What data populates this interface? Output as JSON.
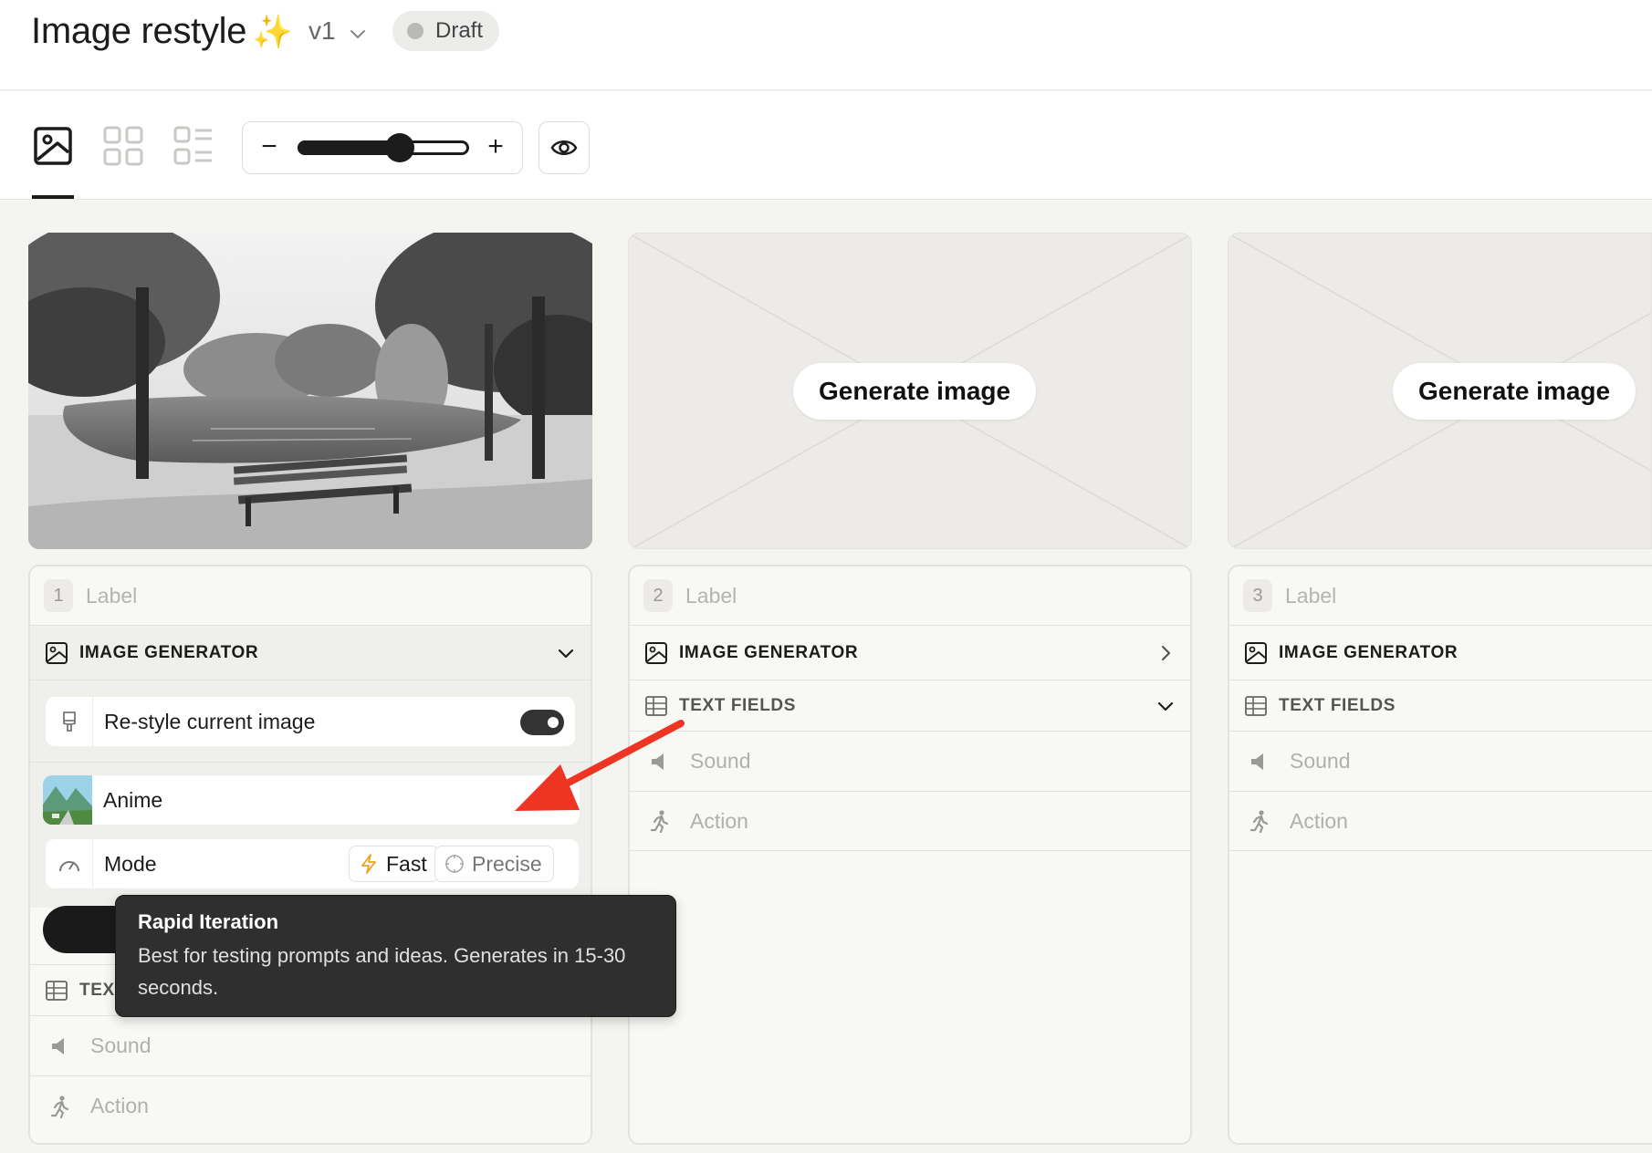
{
  "header": {
    "title": "Image restyle",
    "sparkle": "✨",
    "version": "v1",
    "status": "Draft"
  },
  "toolbar": {
    "view_modes": [
      "single-image-view",
      "grid-view",
      "list-view"
    ],
    "active_view": "single-image-view",
    "zoom_minus": "−",
    "zoom_plus": "+",
    "zoom_level": 0.58
  },
  "columns": [
    {
      "number": "1",
      "label_placeholder": "Label",
      "image_generator_title": "IMAGE GENERATOR",
      "restyle_label": "Re-style current image",
      "restyle_enabled": true,
      "style_name": "Anime",
      "mode_label": "Mode",
      "mode_options": [
        "Fast",
        "Precise"
      ],
      "text_fields_title": "TEXT FIELDS",
      "sound_label": "Sound",
      "action_label": "Action"
    },
    {
      "number": "2",
      "label_placeholder": "Label",
      "generate_label": "Generate image",
      "image_generator_title": "IMAGE GENERATOR",
      "text_fields_title": "TEXT FIELDS",
      "sound_label": "Sound",
      "action_label": "Action"
    },
    {
      "number": "3",
      "label_placeholder": "Label",
      "generate_label": "Generate image",
      "image_generator_title": "IMAGE GENERATOR",
      "text_fields_title": "TEXT FIELDS",
      "sound_label": "Sound",
      "action_label": "Action"
    }
  ],
  "tooltip": {
    "title": "Rapid Iteration",
    "body": "Best for testing prompts and ideas. Generates in 15-30 seconds."
  },
  "colors": {
    "accent_dark": "#1c1c1c",
    "annotation_arrow": "#ee3524",
    "fast_icon": "#f0a020"
  }
}
